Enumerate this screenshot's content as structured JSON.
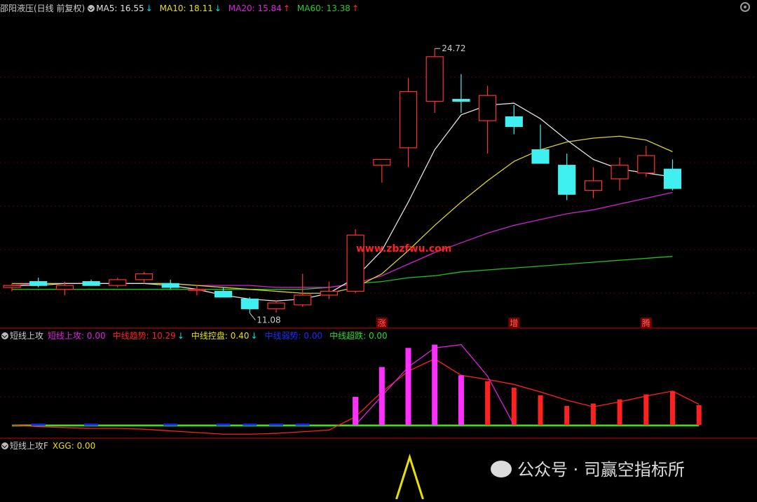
{
  "header_main": {
    "title": "邵阳液压(日线 前复权)",
    "ma": [
      {
        "label": "MA5: 16.55",
        "arrow": "↓",
        "color": "#e0e0e0",
        "arrow_color": "#00e0e0"
      },
      {
        "label": "MA10: 18.11",
        "arrow": "↓",
        "color": "#e8e000",
        "arrow_color": "#00e0e0"
      },
      {
        "label": "MA20: 15.84",
        "arrow": "↑",
        "color": "#e020e0",
        "arrow_color": "#ff3030"
      },
      {
        "label": "MA60: 13.38",
        "arrow": "↑",
        "color": "#20d020",
        "arrow_color": "#ff3030"
      }
    ]
  },
  "header_ind1": {
    "title": "短线上攻",
    "items": [
      {
        "label": "短线上攻: 0.00",
        "arrow": "",
        "color": "#e020e0"
      },
      {
        "label": "中线趋势: 10.29",
        "arrow": "↓",
        "color": "#ff2020",
        "arrow_color": "#00e0e0"
      },
      {
        "label": "中线控盘: 0.40",
        "arrow": "↓",
        "color": "#e8e000",
        "arrow_color": "#00e0e0"
      },
      {
        "label": "中线弱势: 0.00",
        "arrow": "",
        "color": "#1a2aff"
      },
      {
        "label": "中线超跌: 0.00",
        "arrow": "",
        "color": "#20e020"
      }
    ]
  },
  "header_ind2": {
    "title": "短线上攻F",
    "items": [
      {
        "label": "XGG: 0.00",
        "color": "#e8e000"
      }
    ]
  },
  "watermark": "公众号 · 司赢空指标所",
  "site_text": "www.zbzfwu.com",
  "colors": {
    "up": "#ff3030",
    "down": "#40f0f0",
    "ma5": "#e0e0e0",
    "ma10": "#d8d030",
    "ma20": "#d020d0",
    "ma60": "#20c020",
    "grid": "#5a0000"
  },
  "chart_data": [
    {
      "type": "candlestick",
      "title": "邵阳液压(日线 前复权)",
      "ylim": [
        10.3,
        26.5
      ],
      "ohlc": [
        [
          12.4,
          12.6,
          12.2,
          12.5
        ],
        [
          12.7,
          12.9,
          12.4,
          12.5
        ],
        [
          12.3,
          12.7,
          12.0,
          12.5
        ],
        [
          12.7,
          12.8,
          12.5,
          12.5
        ],
        [
          12.5,
          12.9,
          12.4,
          12.8
        ],
        [
          12.8,
          13.2,
          12.6,
          13.1
        ],
        [
          12.6,
          12.8,
          12.3,
          12.4
        ],
        [
          12.3,
          12.5,
          12.0,
          12.3
        ],
        [
          12.2,
          12.4,
          11.9,
          11.9
        ],
        [
          11.8,
          11.9,
          11.08,
          11.3
        ],
        [
          11.3,
          11.7,
          11.1,
          11.6
        ],
        [
          11.5,
          13.1,
          11.4,
          12.0
        ],
        [
          12.0,
          12.7,
          11.8,
          12.2
        ],
        [
          12.2,
          15.4,
          12.1,
          15.1
        ],
        [
          18.7,
          18.9,
          17.8,
          19.0
        ],
        [
          19.6,
          23.2,
          18.6,
          22.5
        ],
        [
          22.0,
          24.72,
          21.4,
          24.3
        ],
        [
          22.1,
          23.4,
          21.4,
          22.0
        ],
        [
          21.0,
          22.8,
          19.3,
          22.3
        ],
        [
          21.2,
          21.8,
          20.3,
          20.7
        ],
        [
          19.5,
          20.8,
          19.0,
          18.8
        ],
        [
          18.7,
          19.3,
          16.9,
          17.2
        ],
        [
          17.4,
          18.6,
          17.0,
          17.9
        ],
        [
          18.0,
          19.1,
          17.4,
          18.7
        ],
        [
          18.3,
          19.7,
          18.1,
          19.2
        ],
        [
          18.5,
          19.0,
          17.4,
          17.5
        ]
      ],
      "ma5": [
        12.5,
        12.5,
        12.6,
        12.6,
        12.6,
        12.6,
        12.5,
        12.3,
        12.0,
        11.8,
        11.7,
        11.8,
        12.1,
        12.9,
        14.3,
        16.8,
        19.5,
        21.3,
        21.8,
        21.9,
        21.1,
        20.0,
        19.0,
        18.5,
        18.3,
        18.1
      ],
      "ma10": [
        12.6,
        12.6,
        12.6,
        12.6,
        12.6,
        12.6,
        12.6,
        12.5,
        12.4,
        12.3,
        12.2,
        12.1,
        12.1,
        12.4,
        13.1,
        14.3,
        15.6,
        16.8,
        17.9,
        18.9,
        19.5,
        19.9,
        20.1,
        20.2,
        20.0,
        19.4
      ],
      "ma20": [
        12.5,
        12.6,
        12.6,
        12.6,
        12.6,
        12.6,
        12.6,
        12.5,
        12.5,
        12.5,
        12.4,
        12.4,
        12.4,
        12.6,
        13.0,
        13.6,
        14.2,
        14.7,
        15.2,
        15.6,
        15.9,
        16.2,
        16.4,
        16.7,
        17.0,
        17.3
      ],
      "ma60": [
        12.3,
        12.3,
        12.3,
        12.3,
        12.3,
        12.3,
        12.3,
        12.3,
        12.3,
        12.3,
        12.3,
        12.3,
        12.4,
        12.6,
        12.7,
        12.9,
        13.0,
        13.2,
        13.3,
        13.4,
        13.5,
        13.6,
        13.7,
        13.8,
        13.9,
        14.0
      ],
      "annotations": [
        {
          "label": "24.72",
          "index": 16
        },
        {
          "label": "11.08",
          "index": 9
        }
      ],
      "markers": [
        {
          "label": "涨",
          "index": 14
        },
        {
          "label": "增",
          "index": 19
        },
        {
          "label": "腾",
          "index": 24
        }
      ]
    },
    {
      "type": "bar",
      "title": "短线上攻",
      "ylim": [
        -1.5,
        10
      ],
      "red_line": [
        0,
        -0.2,
        -0.3,
        -0.4,
        -0.4,
        -0.5,
        -0.7,
        -0.9,
        -1.1,
        -1.1,
        -1.0,
        -0.8,
        -0.6,
        1.0,
        4.0,
        6.5,
        8.0,
        6.0,
        5.5,
        4.9,
        4.0,
        3.0,
        2.2,
        2.8,
        3.5,
        4.1,
        2.5
      ],
      "pink_line": [
        null,
        null,
        null,
        null,
        null,
        null,
        null,
        null,
        null,
        null,
        null,
        null,
        null,
        0,
        3.5,
        7.0,
        9.3,
        9.7,
        5.9,
        0
      ],
      "green_line": [
        0,
        0,
        0,
        0,
        0,
        0,
        0,
        0,
        0,
        0,
        0,
        0,
        0,
        0,
        0,
        0,
        0,
        0,
        0,
        0,
        0,
        0,
        0,
        0,
        0,
        0,
        0
      ],
      "pink_bars": [
        {
          "index": 13,
          "value": 3.4
        },
        {
          "index": 14,
          "value": 7.0
        },
        {
          "index": 15,
          "value": 9.3
        },
        {
          "index": 16,
          "value": 9.7
        },
        {
          "index": 17,
          "value": 6.0
        }
      ],
      "red_bars": [
        {
          "index": 18,
          "value": 5.3
        },
        {
          "index": 19,
          "value": 4.5
        },
        {
          "index": 20,
          "value": 3.6
        },
        {
          "index": 21,
          "value": 2.3
        },
        {
          "index": 22,
          "value": 2.6
        },
        {
          "index": 23,
          "value": 3.1
        },
        {
          "index": 24,
          "value": 3.7
        },
        {
          "index": 25,
          "value": 4.1
        },
        {
          "index": 26,
          "value": 2.4
        }
      ],
      "blue_bars": [
        {
          "index": 1,
          "value": 0.1
        },
        {
          "index": 3,
          "value": 0.1
        },
        {
          "index": 6,
          "value": 0.1
        },
        {
          "index": 8,
          "value": 0.1
        },
        {
          "index": 9,
          "value": 0.2
        },
        {
          "index": 10,
          "value": 0.1
        },
        {
          "index": 11,
          "value": -0.1
        }
      ]
    },
    {
      "type": "line",
      "title": "短线上攻F",
      "ylim": [
        0,
        1
      ],
      "xgg_spike_index": 15,
      "xgg_spike_value": 1.0
    }
  ]
}
